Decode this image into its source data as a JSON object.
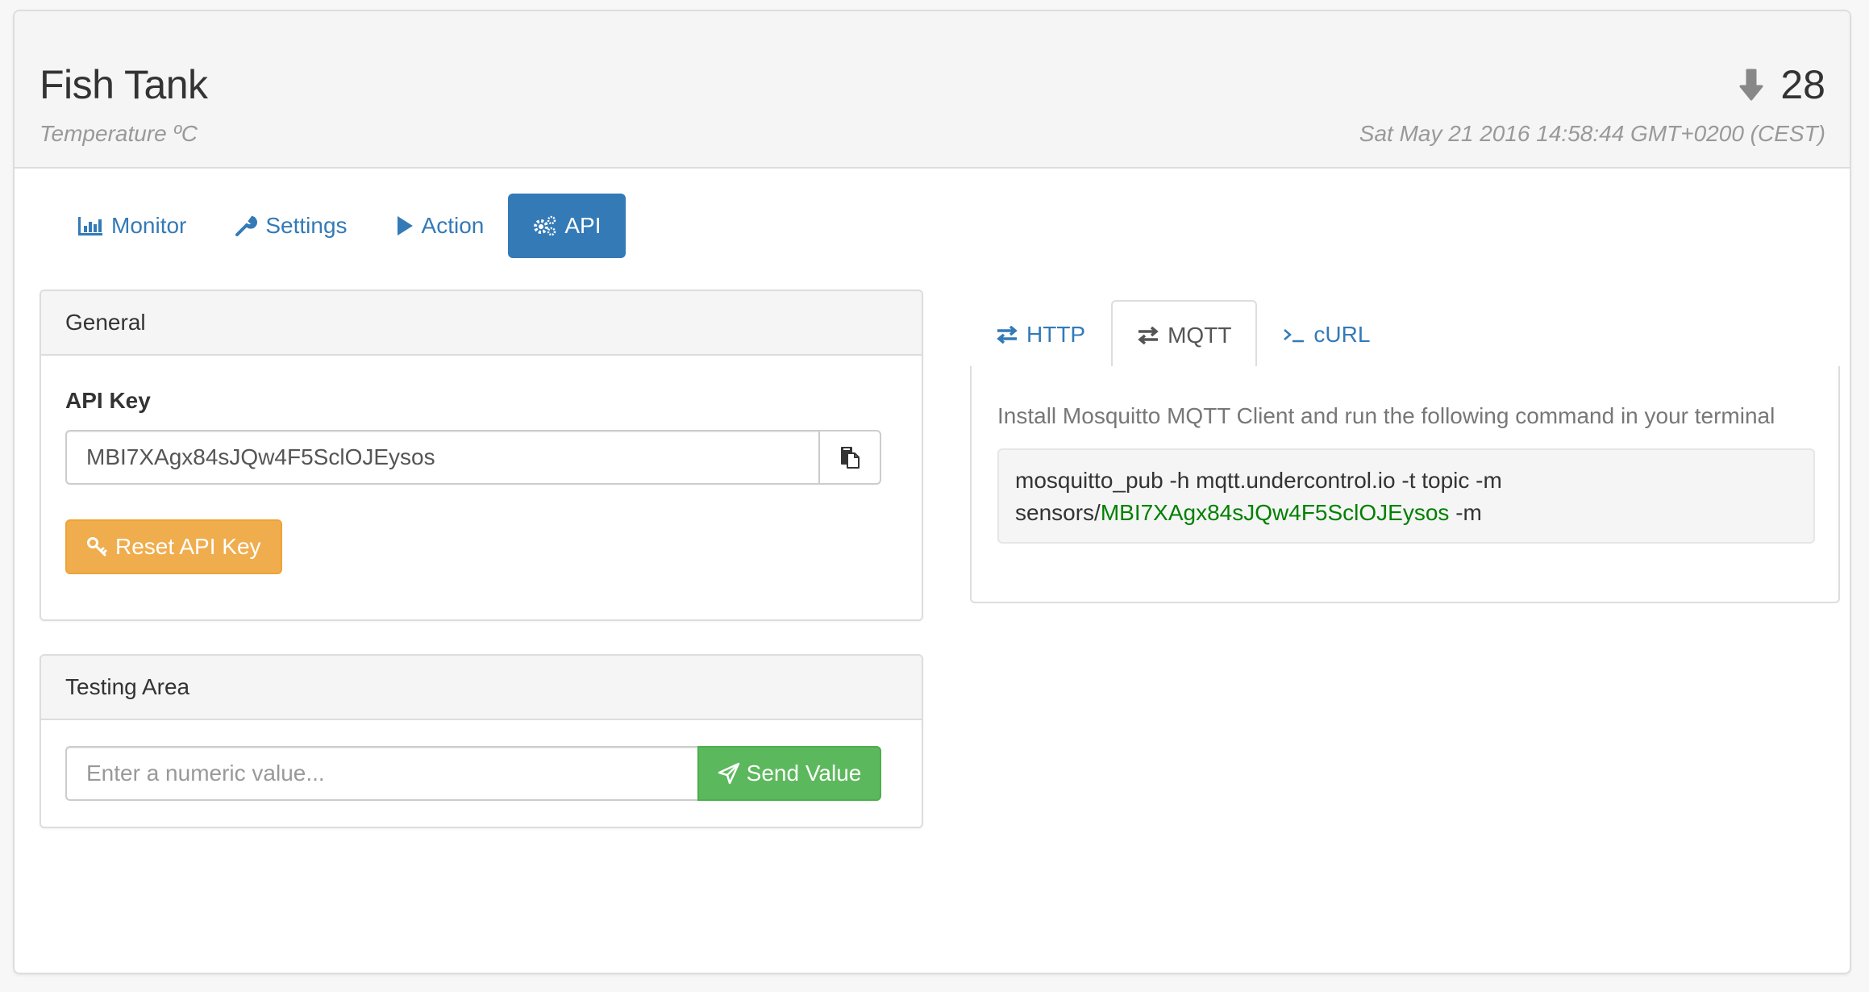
{
  "header": {
    "title": "Fish Tank",
    "subtitle": "Temperature ºC",
    "trend_icon": "arrow-down-icon",
    "value": "28",
    "timestamp": "Sat May 21 2016 14:58:44 GMT+0200 (CEST)"
  },
  "nav": {
    "items": [
      {
        "label": "Monitor",
        "icon": "bar-chart-icon",
        "active": false
      },
      {
        "label": "Settings",
        "icon": "wrench-icon",
        "active": false
      },
      {
        "label": "Action",
        "icon": "play-icon",
        "active": false
      },
      {
        "label": "API",
        "icon": "cogs-icon",
        "active": true
      }
    ]
  },
  "general": {
    "heading": "General",
    "api_key_label": "API Key",
    "api_key_value": "MBI7XAgx84sJQw4F5SclOJEysos",
    "copy_icon": "paste-icon",
    "reset_button": "Reset API Key",
    "reset_icon": "key-icon"
  },
  "testing": {
    "heading": "Testing Area",
    "input_placeholder": "Enter a numeric value...",
    "input_value": "",
    "send_button": "Send Value",
    "send_icon": "paper-plane-icon"
  },
  "api_tabs": {
    "items": [
      {
        "label": "HTTP",
        "icon": "transfer-icon",
        "active": false
      },
      {
        "label": "MQTT",
        "icon": "transfer-icon",
        "active": true
      },
      {
        "label": "cURL",
        "icon": "console-icon",
        "active": false
      }
    ],
    "mqtt": {
      "instructions": "Install Mosquitto MQTT Client and run the following command in your terminal",
      "command_line1": "mosquitto_pub -h mqtt.undercontrol.io -t topic -m",
      "command_prefix": "sensors/",
      "command_key": "MBI7XAgx84sJQw4F5SclOJEysos",
      "command_suffix": " -m"
    }
  },
  "colors": {
    "primary": "#337ab7",
    "warning": "#f0ad4e",
    "success": "#5cb85c",
    "key_highlight": "#008000"
  }
}
